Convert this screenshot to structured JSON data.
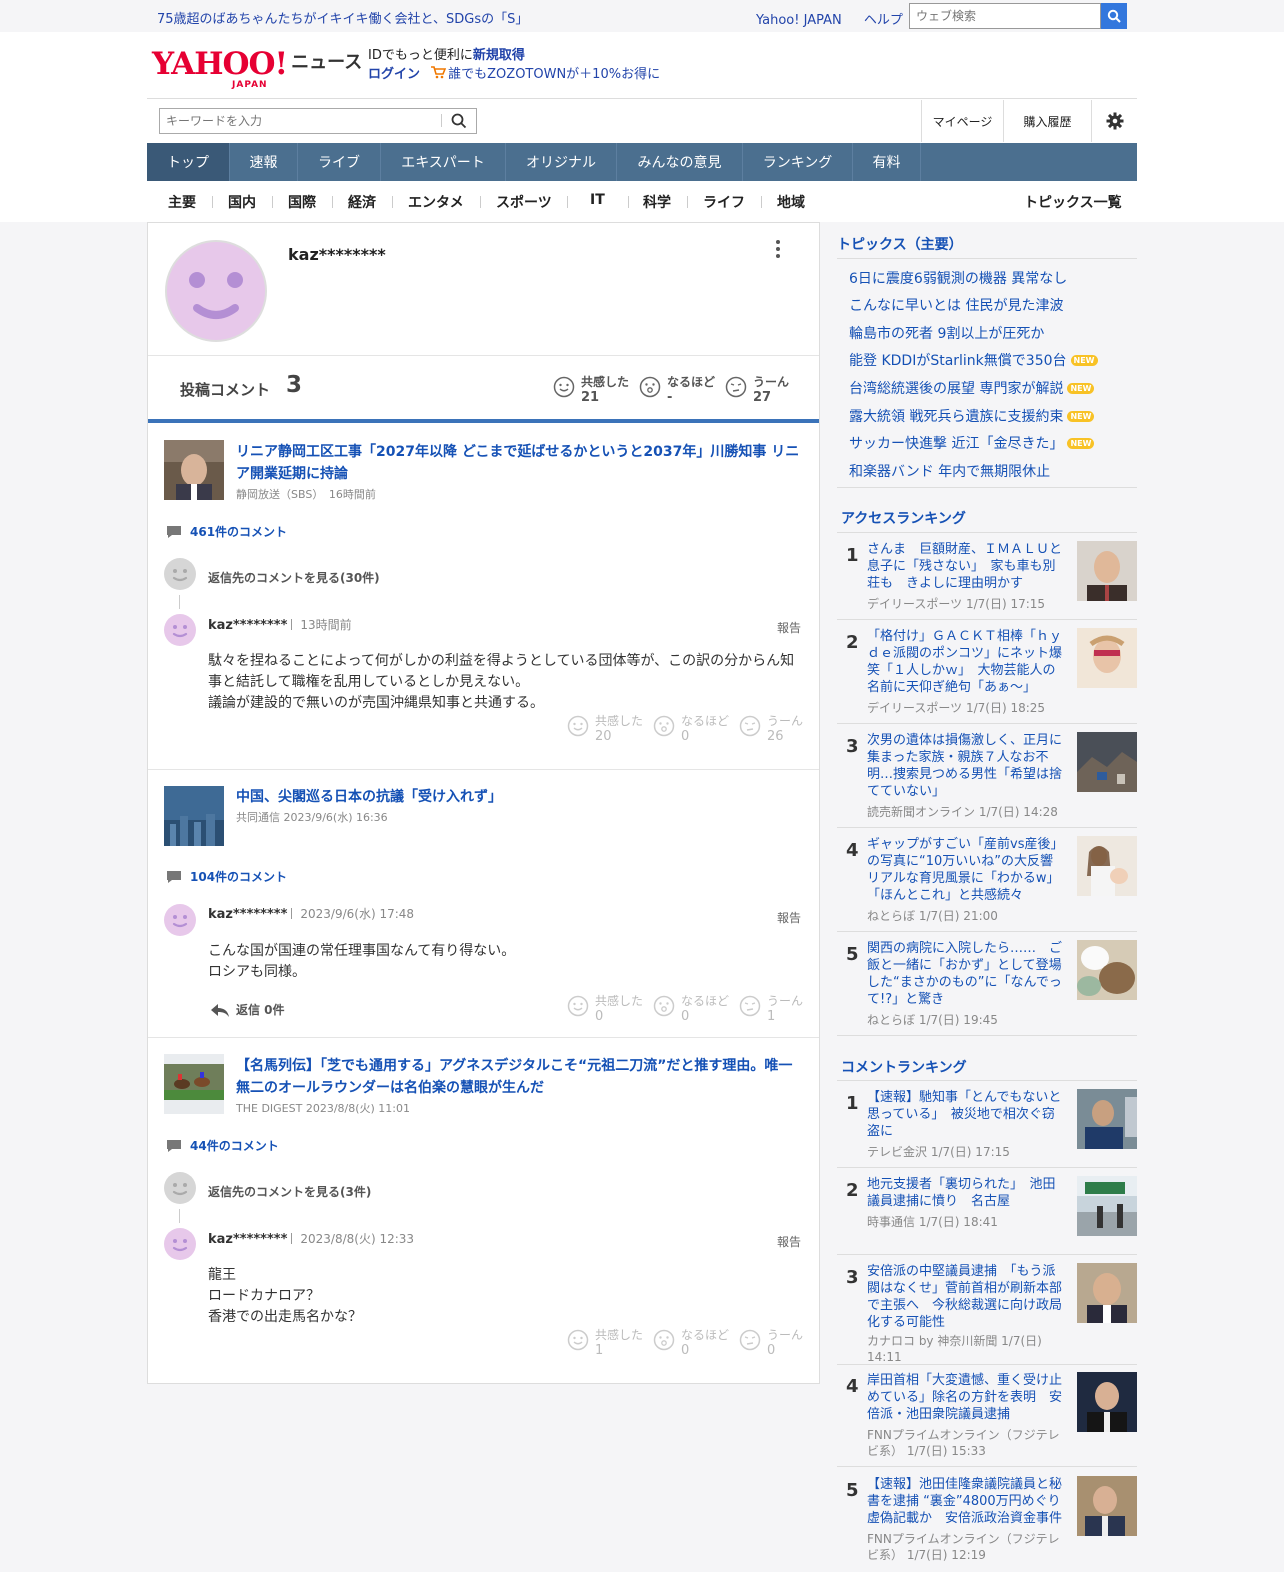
{
  "top": {
    "promo": "75歳超のばあちゃんたちがイキイキ働く会社と、SDGsの「S」",
    "links": [
      "Yahoo! JAPAN",
      "ヘルプ"
    ],
    "web_search_placeholder": "ウェブ検索"
  },
  "header": {
    "logo_text": "YAHOO!",
    "logo_sub": "JAPAN",
    "logo_news": "ニュース",
    "id_line_prefix": "IDでもっと便利に",
    "id_line_link": "新規取得",
    "login": "ログイン",
    "promo2": "誰でもZOZOTOWNが＋10%お得に",
    "keyword_placeholder": "キーワードを入力",
    "mypage": "マイページ",
    "purchase": "購入履歴"
  },
  "nav": {
    "tabs": [
      "トップ",
      "速報",
      "ライブ",
      "エキスパート",
      "オリジナル",
      "みんなの意見",
      "ランキング",
      "有料"
    ]
  },
  "subnav": {
    "items": [
      "主要",
      "国内",
      "国際",
      "経済",
      "エンタメ",
      "スポーツ",
      "IT",
      "科学",
      "ライフ",
      "地域"
    ],
    "topics_all": "トピックス一覧"
  },
  "profile": {
    "username": "kaz********",
    "post_label": "投稿コメント",
    "post_count": "3",
    "reactions": [
      {
        "label": "共感した",
        "value": "21"
      },
      {
        "label": "なるほど",
        "value": "-"
      },
      {
        "label": "うーん",
        "value": "27"
      }
    ]
  },
  "articles": [
    {
      "title": "リニア静岡工区工事「2027年以降 どこまで延ばせるかというと2037年」川勝知事 リニア開業延期に持論",
      "source": "静岡放送（SBS）　16時間前",
      "comments": "461件のコメント",
      "see_prev": "返信先のコメントを見る(30件)",
      "user": "kaz********",
      "time": "13時間前",
      "report": "報告",
      "lines": [
        "駄々を捏ねることによって何がしかの利益を得ようとしている団体等が、この訳の分からん知事と結託して職権を乱用しているとしか見えない。",
        "議論が建設的で無いのが売国沖縄県知事と共通する。"
      ],
      "reactions": [
        {
          "label": "共感した",
          "value": "20"
        },
        {
          "label": "なるほど",
          "value": "0"
        },
        {
          "label": "うーん",
          "value": "26"
        }
      ]
    },
    {
      "title": "中国、尖閣巡る日本の抗議「受け入れず」",
      "source": "共同通信 2023/9/6(水) 16:36",
      "comments": "104件のコメント",
      "user": "kaz********",
      "time": "2023/9/6(水) 17:48",
      "report": "報告",
      "lines": [
        "こんな国が国連の常任理事国なんて有り得ない。",
        "ロシアも同様。"
      ],
      "reply": "返信 0件",
      "reactions": [
        {
          "label": "共感した",
          "value": "0"
        },
        {
          "label": "なるほど",
          "value": "0"
        },
        {
          "label": "うーん",
          "value": "1"
        }
      ]
    },
    {
      "title": "【名馬列伝】「芝でも通用する」アグネスデジタルこそ“元祖二刀流”だと推す理由。唯一無二のオールラウンダーは名伯楽の慧眼が生んだ",
      "source": "THE DIGEST 2023/8/8(火) 11:01",
      "comments": "44件のコメント",
      "see_prev": "返信先のコメントを見る(3件)",
      "user": "kaz********",
      "time": "2023/8/8(火) 12:33",
      "report": "報告",
      "lines": [
        "龍王",
        "ロードカナロア？",
        "香港での出走馬名かな？"
      ],
      "reactions": [
        {
          "label": "共感した",
          "value": "1"
        },
        {
          "label": "なるほど",
          "value": "0"
        },
        {
          "label": "うーん",
          "value": "0"
        }
      ]
    }
  ],
  "sidebar": {
    "topics_title": "トピックス（主要）",
    "new_badge": "NEW",
    "topics": [
      {
        "text": "6日に震度6弱観測の機器 異常なし",
        "new": false
      },
      {
        "text": "こんなに早いとは 住民が見た津波",
        "new": false
      },
      {
        "text": "輪島市の死者 9割以上が圧死か",
        "new": false
      },
      {
        "text": "能登 KDDIがStarlink無償で350台",
        "new": true
      },
      {
        "text": "台湾総統選後の展望 専門家が解説",
        "new": true
      },
      {
        "text": "露大統領 戦死兵ら遺族に支援約束",
        "new": true
      },
      {
        "text": "サッカー快進撃 近江「金尽きた」",
        "new": true
      },
      {
        "text": "和楽器バンド 年内で無期限休止",
        "new": false
      }
    ],
    "access_title": "アクセスランキング",
    "access": [
      {
        "rank": "1",
        "title": "さんま　巨額財産、ＩＭＡＬＵと息子に「残さない」　家も車も別荘も　きよしに理由明かす",
        "source": "デイリースポーツ 1/7(日) 17:15"
      },
      {
        "rank": "2",
        "title": "「格付け」ＧＡＣＫＴ相棒「ｈｙｄｅ派閥のポンコツ」にネット爆笑「１人しかｗ」　大物芸能人の名前に天仰ぎ絶句「あぁ～」",
        "source": "デイリースポーツ 1/7(日) 18:25"
      },
      {
        "rank": "3",
        "title": "次男の遺体は損傷激しく、正月に集まった家族・親族７人なお不明…捜索見つめる男性「希望は捨てていない」",
        "source": "読売新聞オンライン 1/7(日) 14:28"
      },
      {
        "rank": "4",
        "title": "ギャップがすごい「産前vs産後」の写真に“10万いいね”の大反響 リアルな育児風景に「わかるw」「ほんとこれ」と共感続々",
        "source": "ねとらぼ 1/7(日) 21:00"
      },
      {
        "rank": "5",
        "title": "関西の病院に入院したら……　ご飯と一緒に「おかず」として登場した“まさかのもの”に「なんでって!?」と驚き",
        "source": "ねとらぼ 1/7(日) 19:45"
      }
    ],
    "comment_title": "コメントランキング",
    "comment": [
      {
        "rank": "1",
        "title": "【速報】馳知事「とんでもないと思っている」　被災地で相次ぐ窃盗に",
        "source": "テレビ金沢 1/7(日) 17:15"
      },
      {
        "rank": "2",
        "title": "地元支援者「裏切られた」　池田議員逮捕に憤り　名古屋",
        "source": "時事通信 1/7(日) 18:41"
      },
      {
        "rank": "3",
        "title": "安倍派の中堅議員逮捕　「もう派閥はなくせ」菅前首相が刷新本部で主張へ　今秋総裁選に向け政局化する可能性",
        "source": "カナロコ by 神奈川新聞 1/7(日) 14:11"
      },
      {
        "rank": "4",
        "title": "岸田首相「大変遺憾、重く受け止めている」除名の方針を表明　安倍派・池田衆院議員逮捕",
        "source": "FNNプライムオンライン（フジテレビ系） 1/7(日) 15:33"
      },
      {
        "rank": "5",
        "title": "【速報】池田佳隆衆議院議員と秘書を逮捕 “裏金”4800万円めぐり虚偽記載か　安倍派政治資金事件",
        "source": "FNNプライムオンライン（フジテレビ系） 1/7(日) 12:19"
      }
    ]
  }
}
